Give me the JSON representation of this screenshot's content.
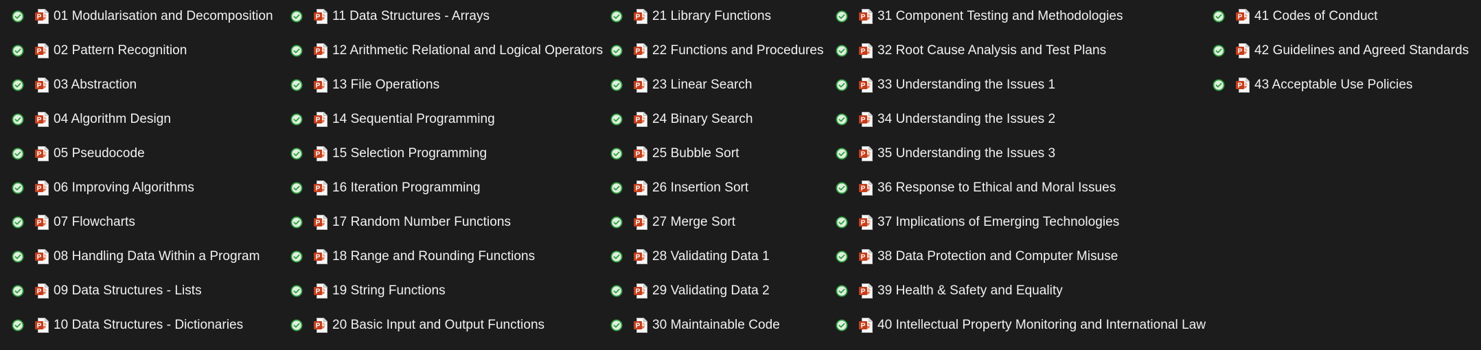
{
  "view": {
    "type": "file-list",
    "background_color": "#1c1c1c",
    "text_color": "#f2f2f2",
    "status_icon": "sync-complete-check-icon",
    "status_color": "#2e9e3e",
    "file_icon": "powerpoint-file-icon",
    "file_icon_color": "#c43e1c"
  },
  "columns": [
    {
      "items": [
        {
          "name": "01 Modularisation and Decomposition",
          "status": "synced",
          "type": "pptx"
        },
        {
          "name": "02 Pattern Recognition",
          "status": "synced",
          "type": "pptx"
        },
        {
          "name": "03 Abstraction",
          "status": "synced",
          "type": "pptx"
        },
        {
          "name": "04 Algorithm Design",
          "status": "synced",
          "type": "pptx"
        },
        {
          "name": "05 Pseudocode",
          "status": "synced",
          "type": "pptx"
        },
        {
          "name": "06 Improving Algorithms",
          "status": "synced",
          "type": "pptx"
        },
        {
          "name": "07 Flowcharts",
          "status": "synced",
          "type": "pptx"
        },
        {
          "name": "08 Handling Data Within a Program",
          "status": "synced",
          "type": "pptx"
        },
        {
          "name": "09 Data Structures - Lists",
          "status": "synced",
          "type": "pptx"
        },
        {
          "name": "10 Data Structures - Dictionaries",
          "status": "synced",
          "type": "pptx"
        }
      ]
    },
    {
      "items": [
        {
          "name": "11 Data Structures - Arrays",
          "status": "synced",
          "type": "pptx"
        },
        {
          "name": "12 Arithmetic Relational and Logical Operators",
          "status": "synced",
          "type": "pptx"
        },
        {
          "name": "13 File Operations",
          "status": "synced",
          "type": "pptx"
        },
        {
          "name": "14 Sequential Programming",
          "status": "synced",
          "type": "pptx"
        },
        {
          "name": "15 Selection Programming",
          "status": "synced",
          "type": "pptx"
        },
        {
          "name": "16 Iteration Programming",
          "status": "synced",
          "type": "pptx"
        },
        {
          "name": "17 Random Number Functions",
          "status": "synced",
          "type": "pptx"
        },
        {
          "name": "18 Range and Rounding Functions",
          "status": "synced",
          "type": "pptx"
        },
        {
          "name": "19 String Functions",
          "status": "synced",
          "type": "pptx"
        },
        {
          "name": "20 Basic Input and Output Functions",
          "status": "synced",
          "type": "pptx"
        }
      ]
    },
    {
      "items": [
        {
          "name": "21 Library Functions",
          "status": "synced",
          "type": "pptx"
        },
        {
          "name": "22 Functions and Procedures",
          "status": "synced",
          "type": "pptx"
        },
        {
          "name": "23 Linear Search",
          "status": "synced",
          "type": "pptx"
        },
        {
          "name": "24 Binary Search",
          "status": "synced",
          "type": "pptx"
        },
        {
          "name": "25 Bubble Sort",
          "status": "synced",
          "type": "pptx"
        },
        {
          "name": "26 Insertion Sort",
          "status": "synced",
          "type": "pptx"
        },
        {
          "name": "27 Merge Sort",
          "status": "synced",
          "type": "pptx"
        },
        {
          "name": "28 Validating Data 1",
          "status": "synced",
          "type": "pptx"
        },
        {
          "name": "29 Validating Data 2",
          "status": "synced",
          "type": "pptx"
        },
        {
          "name": "30 Maintainable Code",
          "status": "synced",
          "type": "pptx"
        }
      ]
    },
    {
      "items": [
        {
          "name": "31 Component Testing and Methodologies",
          "status": "synced",
          "type": "pptx"
        },
        {
          "name": "32 Root Cause Analysis and Test Plans",
          "status": "synced",
          "type": "pptx"
        },
        {
          "name": "33 Understanding the Issues 1",
          "status": "synced",
          "type": "pptx"
        },
        {
          "name": "34 Understanding the Issues 2",
          "status": "synced",
          "type": "pptx"
        },
        {
          "name": "35 Understanding the Issues 3",
          "status": "synced",
          "type": "pptx"
        },
        {
          "name": "36 Response to Ethical and Moral Issues",
          "status": "synced",
          "type": "pptx"
        },
        {
          "name": "37 Implications of Emerging Technologies",
          "status": "synced",
          "type": "pptx"
        },
        {
          "name": "38 Data Protection and Computer Misuse",
          "status": "synced",
          "type": "pptx"
        },
        {
          "name": "39 Health & Safety and Equality",
          "status": "synced",
          "type": "pptx"
        },
        {
          "name": "40 Intellectual Property Monitoring and International Law",
          "status": "synced",
          "type": "pptx"
        }
      ]
    },
    {
      "items": [
        {
          "name": "41 Codes of Conduct",
          "status": "synced",
          "type": "pptx"
        },
        {
          "name": "42 Guidelines and Agreed Standards",
          "status": "synced",
          "type": "pptx"
        },
        {
          "name": "43 Acceptable Use Policies",
          "status": "synced",
          "type": "pptx"
        }
      ]
    }
  ]
}
